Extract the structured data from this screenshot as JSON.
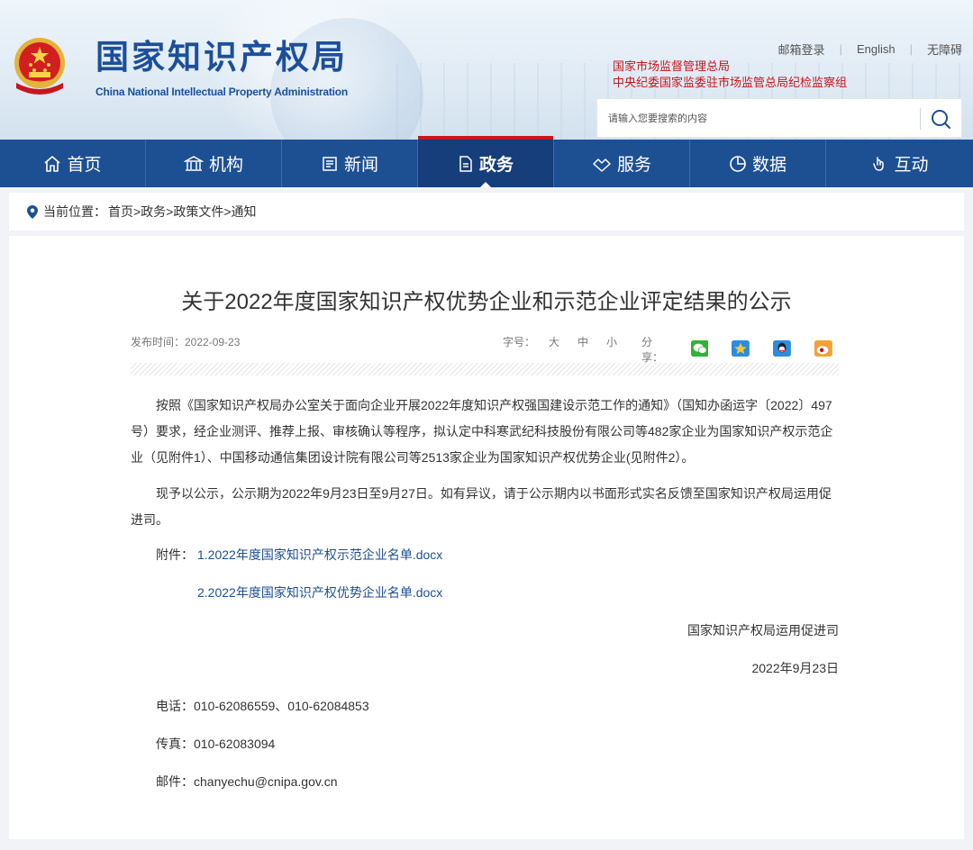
{
  "header": {
    "site_title": "国家知识产权局",
    "site_subtitle": "China National Intellectual Property Administration",
    "top_links": [
      "邮箱登录",
      "English",
      "无障碍"
    ],
    "org_links": [
      "国家市场监督管理总局",
      "中央纪委国家监委驻市场监管总局纪检监察组"
    ],
    "search": {
      "placeholder": "请输入您要搜索的内容"
    }
  },
  "nav": {
    "items": [
      {
        "label": "首页",
        "icon": "home-icon"
      },
      {
        "label": "机构",
        "icon": "institution-icon"
      },
      {
        "label": "新闻",
        "icon": "news-icon"
      },
      {
        "label": "政务",
        "icon": "document-icon",
        "active": true
      },
      {
        "label": "服务",
        "icon": "service-icon"
      },
      {
        "label": "数据",
        "icon": "pie-chart-icon"
      },
      {
        "label": "互动",
        "icon": "interaction-icon"
      }
    ]
  },
  "breadcrumb": {
    "label": "当前位置：",
    "path": "首页>政务>政策文件>通知"
  },
  "article": {
    "title": "关于2022年度国家知识产权优势企业和示范企业评定结果的公示",
    "date": "发布时间：2022-09-23",
    "font_size": {
      "label": "字号：",
      "options": [
        "大",
        "中",
        "小"
      ]
    },
    "share": {
      "label": "分享：",
      "targets": [
        "wechat-icon",
        "qzone-icon",
        "qq-icon",
        "weibo-icon"
      ]
    },
    "paragraphs": [
      "按照《国家知识产权局办公室关于面向企业开展2022年度知识产权强国建设示范工作的通知》（国知办函运字〔2022〕497号）要求，经企业测评、推荐上报、审核确认等程序，拟认定中科寒武纪科技股份有限公司等482家企业为国家知识产权示范企业（见附件1）、中国移动通信集团设计院有限公司等2513家企业为国家知识产权优势企业(见附件2）。",
      "现予以公示，公示期为2022年9月23日至9月27日。如有异议，请于公示期内以书面形式实名反馈至国家知识产权局运用促进司。"
    ],
    "attachments": {
      "label": "附件：",
      "items": [
        "1.2022年度国家知识产权示范企业名单.docx",
        "2.2022年度国家知识产权优势企业名单.docx"
      ]
    },
    "signature": {
      "org": "国家知识产权局运用促进司",
      "date": "2022年9月23日"
    },
    "contacts": {
      "phone": "电话：010-62086559、010-62084853",
      "fax": "传真：010-62083094",
      "email": "邮件：chanyechu@cnipa.gov.cn"
    }
  },
  "colors": {
    "brand_blue": "#1d4f93",
    "accent_red": "#c8161d"
  }
}
